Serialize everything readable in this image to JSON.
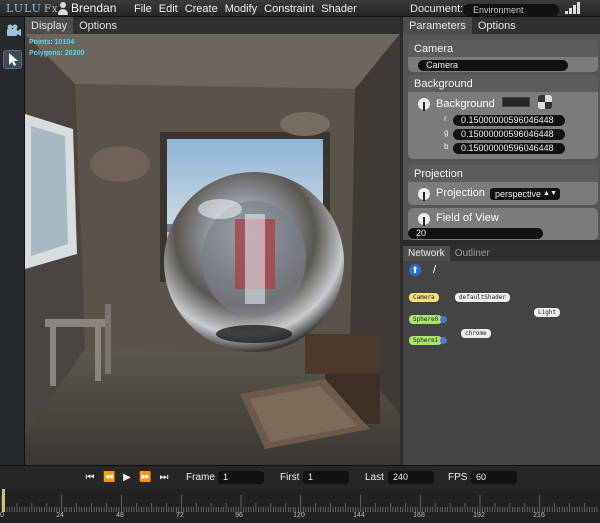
{
  "app": {
    "logo": "LULU",
    "logo_fx": "Fx",
    "user": "Brendan"
  },
  "menu": [
    "File",
    "Edit",
    "Create",
    "Modify",
    "Constraint",
    "Shader"
  ],
  "document": {
    "label": "Document:",
    "value": "Environment"
  },
  "viewport": {
    "tabs": [
      "Display",
      "Options"
    ],
    "stats": {
      "points": "Points: 10104",
      "polygons": "Polygons: 20200"
    }
  },
  "panel": {
    "tabs": [
      "Parameters",
      "Options"
    ],
    "camera": {
      "header": "Camera",
      "value": "Camera"
    },
    "background": {
      "header": "Background",
      "label": "Background",
      "channels": [
        {
          "name": "r",
          "value": "0.15000000596046448"
        },
        {
          "name": "g",
          "value": "0.15000000596046448"
        },
        {
          "name": "b",
          "value": "0.15000000596046448"
        }
      ],
      "color": "#262626"
    },
    "projection": {
      "header": "Projection",
      "label": "Projection",
      "value": "perspective"
    },
    "fov": {
      "label": "Field of View",
      "value": "20"
    }
  },
  "network": {
    "tabs": [
      "Network",
      "Outliner"
    ],
    "path": "/",
    "nodes": {
      "camera": "Camera",
      "default_shader": "defaultShader",
      "light": "Light",
      "sphere0": "Sphere0",
      "chrome": "chrome",
      "sphere1": "Sphere1"
    }
  },
  "transport": {
    "frame_label": "Frame",
    "frame": "1",
    "first_label": "First",
    "first": "1",
    "last_label": "Last",
    "last": "240",
    "fps_label": "FPS",
    "fps": "60"
  },
  "timeline": {
    "ticks": [
      "0",
      "24",
      "48",
      "72",
      "96",
      "120",
      "144",
      "168",
      "192",
      "216"
    ]
  },
  "colors": {
    "accent": "#2d6bd6",
    "stats": "#58d9e8",
    "camera_node": "#f1e07a",
    "sphere_node": "#a9e46a"
  }
}
